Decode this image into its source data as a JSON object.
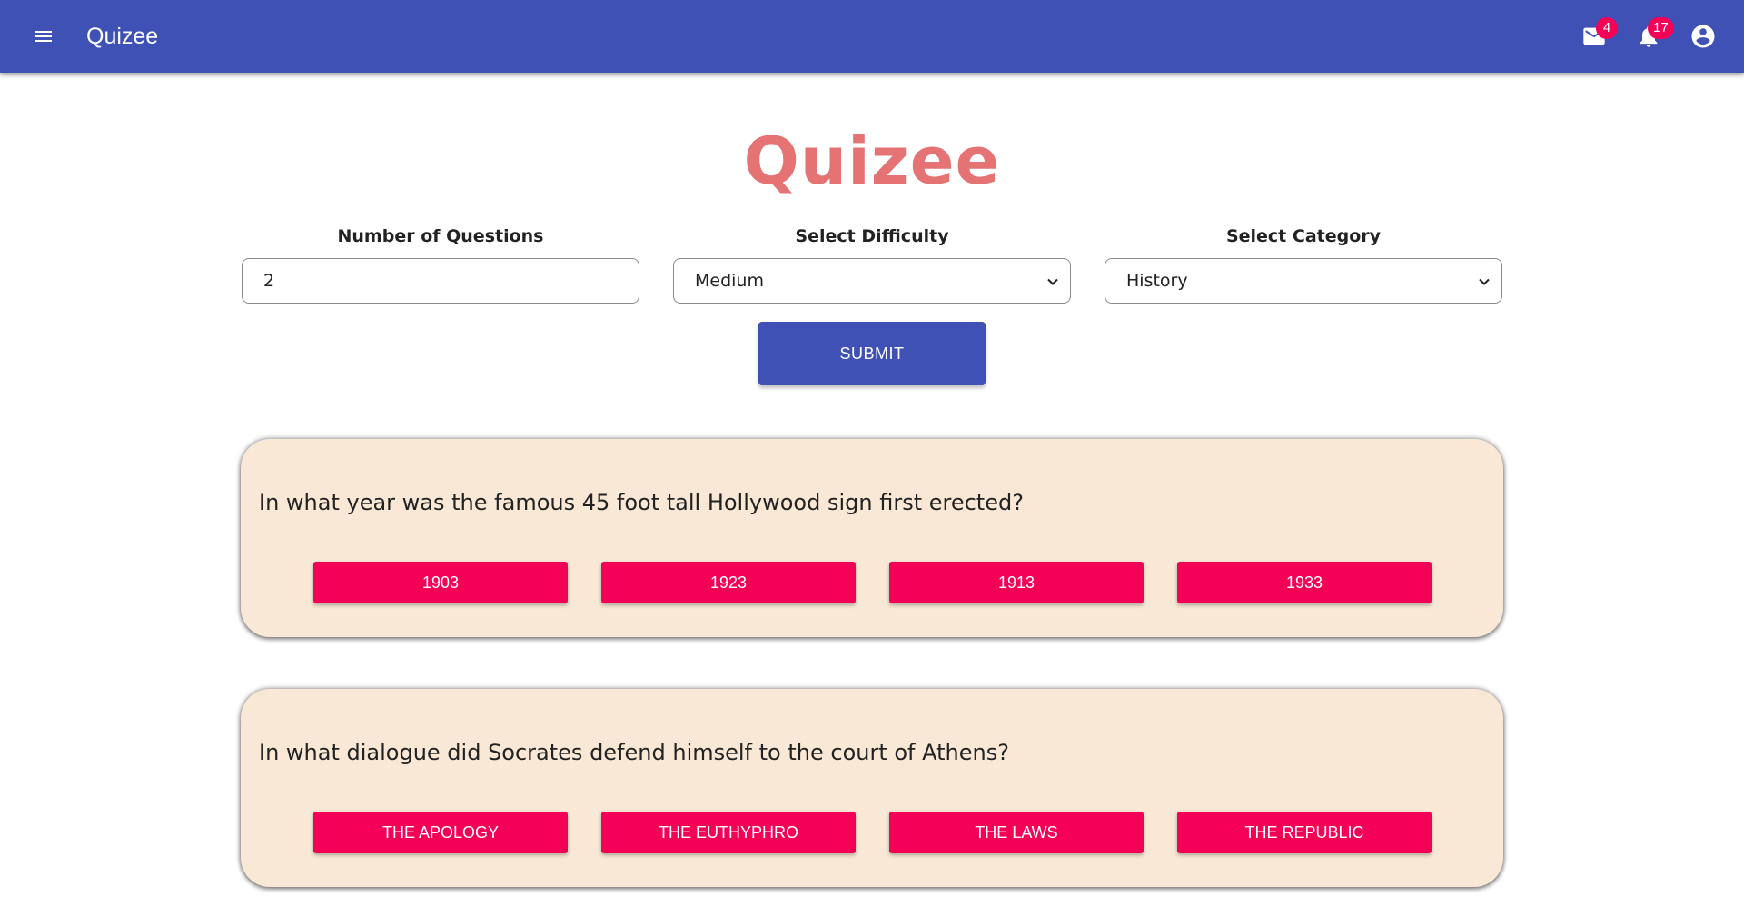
{
  "appbar": {
    "title": "Quizee",
    "mail_badge": "4",
    "notifications_badge": "17",
    "color": "#3f51b5",
    "icons": [
      "menu-icon",
      "mail-icon",
      "notifications-icon",
      "account-circle-icon"
    ]
  },
  "main": {
    "heading": "Quizee",
    "heading_color": "#e57373"
  },
  "form": {
    "questions_label": "Number of Questions",
    "questions_value": "2",
    "difficulty_label": "Select Difficulty",
    "difficulty_value": "Medium",
    "category_label": "Select Category",
    "category_value": "History",
    "submit_label": "SUBMIT"
  },
  "questions": [
    {
      "text": "In what year was the famous 45 foot tall Hollywood sign first erected?",
      "answers": [
        "1903",
        "1923",
        "1913",
        "1933"
      ]
    },
    {
      "text": "In what dialogue did Socrates defend himself to the court of Athens?",
      "answers": [
        "THE APOLOGY",
        "THE EUTHYPHRO",
        "THE LAWS",
        "THE REPUBLIC"
      ]
    }
  ],
  "colors": {
    "answer_button": "#f50057",
    "card_background": "#f9e8d6",
    "badge": "#f50057"
  }
}
